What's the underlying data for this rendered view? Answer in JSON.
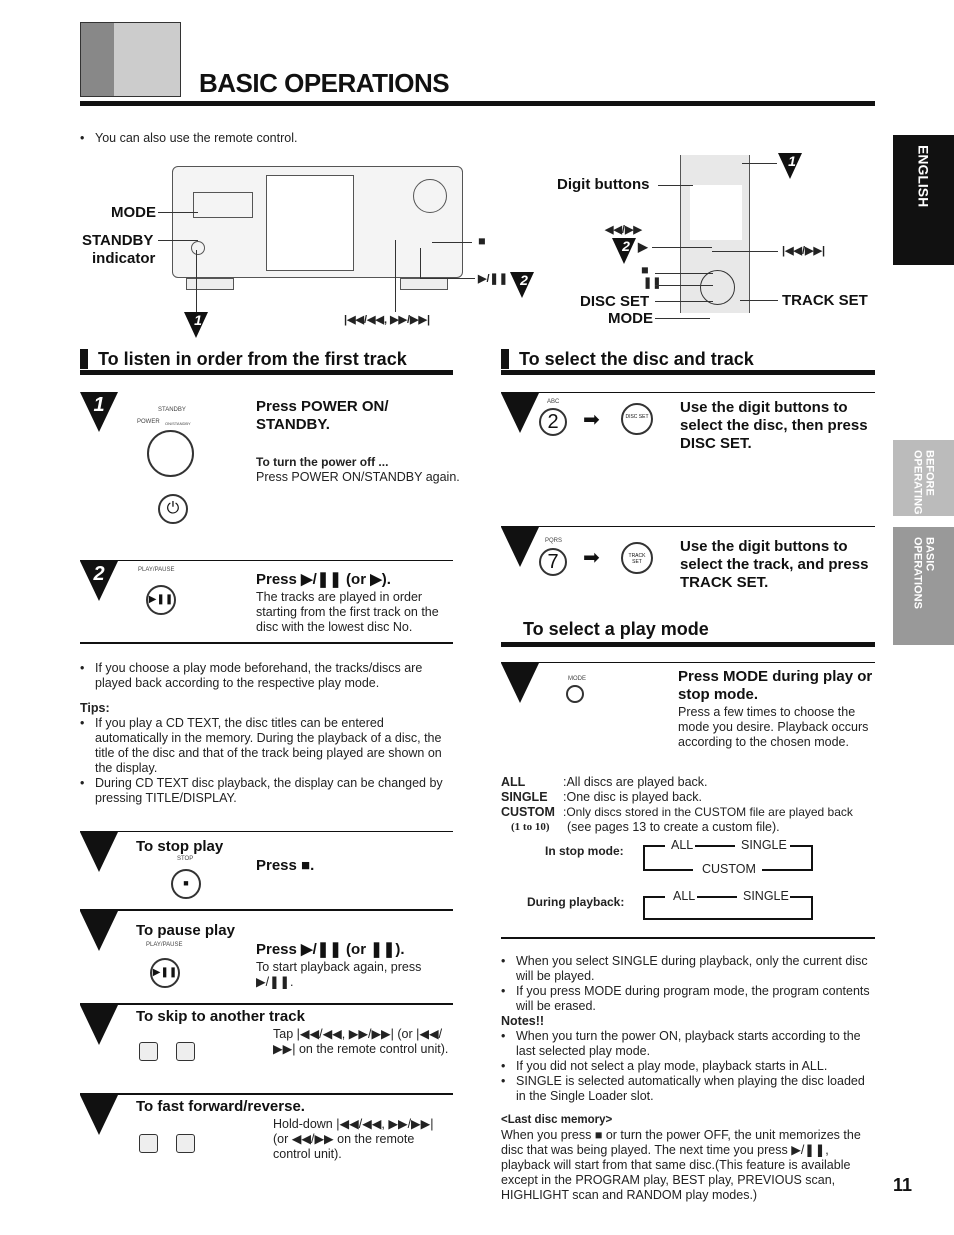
{
  "header": {
    "title": "BASIC OPERATIONS"
  },
  "intro_bullet": "You can also use the remote control.",
  "side_tabs": {
    "english": "ENGLISH",
    "before": "BEFORE OPERATING",
    "basic": "BASIC OPERATIONS"
  },
  "page_number": "11",
  "unit_diagram": {
    "mode": "MODE",
    "standby": "STANDBY",
    "indicator": "indicator",
    "stop": "■",
    "play_pause": "▶/❚❚",
    "skip": "|◀◀/◀◀, ▶▶/▶▶|",
    "step1": "1",
    "step2": "2"
  },
  "remote_diagram": {
    "digit_buttons": "Digit buttons",
    "search": "◀◀/▶▶",
    "play": "▶",
    "skip": "|◀◀/▶▶|",
    "stop": "■",
    "pause": "❚❚",
    "disc_set": "DISC SET",
    "mode": "MODE",
    "track_set": "TRACK SET",
    "step1": "1",
    "step2": "2"
  },
  "listen": {
    "title": "To listen in order from the first track",
    "step1": {
      "num": "1",
      "heading": "Press POWER ON/ STANDBY.",
      "sub": "To turn the power off ...",
      "text": "Press POWER ON/STANDBY again.",
      "lbl_standby": "STANDBY",
      "lbl_power": "POWER",
      "lbl_onstandby": "ON/STANDBY"
    },
    "step2": {
      "num": "2",
      "heading": "Press ▶/❚❚ (or ▶).",
      "text": "The tracks are played in order starting from the first track on the disc with the lowest disc No.",
      "lbl": "PLAY/PAUSE"
    },
    "bullet": "If you choose a play mode beforehand, the tracks/discs are played back according to the respective play mode.",
    "tips_label": "Tips:",
    "tips": [
      "If you play a CD TEXT, the disc titles can be entered automatically in the memory. During the playback of a disc, the title of the disc and that of the track being played are shown on the display.",
      "During CD TEXT disc playback, the display can be changed by pressing TITLE/DISPLAY."
    ]
  },
  "stop": {
    "title": "To stop play",
    "text": "Press ■.",
    "lbl": "STOP"
  },
  "pause": {
    "title": "To pause play",
    "heading": "Press ▶/❚❚ (or ❚❚).",
    "text": "To start playback again, press ▶/❚❚.",
    "lbl": "PLAY/PAUSE"
  },
  "skip": {
    "title": "To skip to another track",
    "text": "Tap |◀◀/◀◀, ▶▶/▶▶| (or |◀◀/ ▶▶| on the remote control unit)."
  },
  "ff": {
    "title": "To fast forward/reverse.",
    "text": "Hold-down |◀◀/◀◀, ▶▶/▶▶| (or ◀◀/▶▶ on the remote control unit)."
  },
  "select": {
    "title": "To select the disc and track",
    "disc": {
      "text": "Use the digit buttons to select the disc, then press DISC SET.",
      "digit": "2",
      "lbl": "ABC",
      "btn": "DISC SET"
    },
    "track": {
      "text": "Use the digit buttons to select the track, and press TRACK SET.",
      "digit": "7",
      "lbl": "PQRS",
      "btn": "TRACK SET"
    }
  },
  "playmode": {
    "title": "To select a play mode",
    "heading": "Press MODE during play or stop mode.",
    "text": "Press a few times to choose the mode you desire. Playback occurs according to the chosen mode.",
    "lbl": "MODE",
    "modes": [
      {
        "name": "ALL",
        "desc": ":All discs are played back."
      },
      {
        "name": "SINGLE",
        "desc": ":One disc is played back."
      },
      {
        "name": "CUSTOM",
        "desc": ":Only discs stored in the CUSTOM file are played back"
      }
    ],
    "custom_range": "(1 to 10)",
    "custom_note": "(see pages 13 to create a custom file).",
    "stop_mode": {
      "label": "In stop mode:",
      "all": "ALL",
      "single": "SINGLE",
      "custom": "CUSTOM"
    },
    "playback": {
      "label": "During playback:",
      "all": "ALL",
      "single": "SINGLE"
    }
  },
  "notes": {
    "bullets": [
      "When you select SINGLE during playback, only the current disc will be played.",
      "If you press MODE during program mode, the program contents will be erased."
    ],
    "label": "Notes!!",
    "items": [
      "When you turn the power ON, playback starts according to the last selected play mode.",
      "If you did not select a play mode, playback starts in ALL.",
      "SINGLE is selected automatically when playing the disc loaded in the Single Loader slot."
    ],
    "memory_title": "<Last disc memory>",
    "memory_text": "When you press ■ or turn the power OFF, the unit memorizes the disc that was being played. The next time you press ▶/❚❚, playback will start from that same disc.(This feature is available except in the PROGRAM play, BEST play, PREVIOUS scan, HIGHLIGHT scan and RANDOM play modes.)"
  }
}
